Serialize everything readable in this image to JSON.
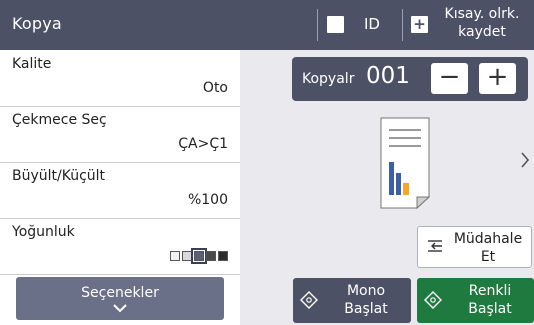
{
  "header": {
    "title": "Kopya",
    "id_label": "ID",
    "shortcut_line1": "Kısay. olrk.",
    "shortcut_line2": "kaydet"
  },
  "settings": [
    {
      "name": "Kalite",
      "value": "Oto"
    },
    {
      "name": "Çekmece Seç",
      "value": "ÇA>Ç1"
    },
    {
      "name": "Büyült/Küçült",
      "value": "%100"
    },
    {
      "name": "Yoğunluk",
      "value": ""
    }
  ],
  "density": {
    "levels": 5,
    "selected": 3
  },
  "options_button": {
    "label": "Seçenekler"
  },
  "copies": {
    "label": "Kopyalr",
    "value": "001",
    "minus": "−",
    "plus": "+"
  },
  "intervene": {
    "line1": "Müdahale",
    "line2": "Et"
  },
  "mono_start": {
    "line1": "Mono",
    "line2": "Başlat"
  },
  "color_start": {
    "line1": "Renkli",
    "line2": "Başlat"
  },
  "colors": {
    "header_bg": "#4d5166",
    "color_start_bg": "#1e7a3e",
    "panel_bg": "#e9e9ee",
    "preview_blue": "#3a5fa8",
    "preview_orange": "#f5a623"
  },
  "icons": [
    "checkbox-icon",
    "plus-square-icon",
    "chevron-down-icon",
    "chevron-right-icon",
    "document-preview-icon",
    "intervene-icon",
    "start-diamond-icon"
  ]
}
